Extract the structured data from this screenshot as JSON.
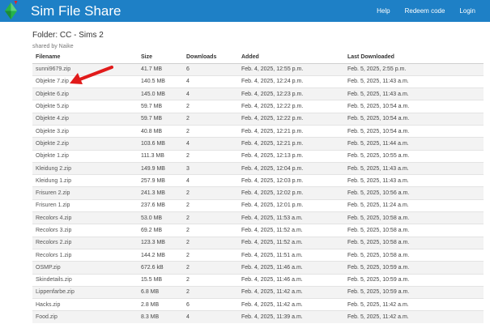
{
  "app": {
    "title": "Sim File Share"
  },
  "colors": {
    "navbar": "#1e80c6",
    "arrow": "#e11b1b",
    "row_alt": "#f3f3f3"
  },
  "nav": {
    "help": "Help",
    "redeem": "Redeem code",
    "login": "Login"
  },
  "folder": {
    "title": "Folder: CC - Sims 2",
    "shared_by": "shared by Naike"
  },
  "table": {
    "headers": {
      "filename": "Filename",
      "size": "Size",
      "downloads": "Downloads",
      "added": "Added",
      "last": "Last Downloaded"
    },
    "rows": [
      {
        "filename": "sunni9679.zip",
        "size": "41.7 MB",
        "downloads": "6",
        "added": "Feb. 4, 2025, 12:55 p.m.",
        "last": "Feb. 5, 2025, 2:55 p.m."
      },
      {
        "filename": "Objekte 7.zip",
        "size": "140.5 MB",
        "downloads": "4",
        "added": "Feb. 4, 2025, 12:24 p.m.",
        "last": "Feb. 5, 2025, 11:43 a.m."
      },
      {
        "filename": "Objekte 6.zip",
        "size": "145.0 MB",
        "downloads": "4",
        "added": "Feb. 4, 2025, 12:23 p.m.",
        "last": "Feb. 5, 2025, 11:43 a.m."
      },
      {
        "filename": "Objekte 5.zip",
        "size": "59.7 MB",
        "downloads": "2",
        "added": "Feb. 4, 2025, 12:22 p.m.",
        "last": "Feb. 5, 2025, 10:54 a.m."
      },
      {
        "filename": "Objekte 4.zip",
        "size": "59.7 MB",
        "downloads": "2",
        "added": "Feb. 4, 2025, 12:22 p.m.",
        "last": "Feb. 5, 2025, 10:54 a.m."
      },
      {
        "filename": "Objekte 3.zip",
        "size": "40.8 MB",
        "downloads": "2",
        "added": "Feb. 4, 2025, 12:21 p.m.",
        "last": "Feb. 5, 2025, 10:54 a.m."
      },
      {
        "filename": "Objekte 2.zip",
        "size": "103.6 MB",
        "downloads": "4",
        "added": "Feb. 4, 2025, 12:21 p.m.",
        "last": "Feb. 5, 2025, 11:44 a.m."
      },
      {
        "filename": "Objekte 1.zip",
        "size": "111.3 MB",
        "downloads": "2",
        "added": "Feb. 4, 2025, 12:13 p.m.",
        "last": "Feb. 5, 2025, 10:55 a.m."
      },
      {
        "filename": "Kleidung 2.zip",
        "size": "149.9 MB",
        "downloads": "3",
        "added": "Feb. 4, 2025, 12:04 p.m.",
        "last": "Feb. 5, 2025, 11:43 a.m."
      },
      {
        "filename": "Kleidung 1.zip",
        "size": "257.9 MB",
        "downloads": "4",
        "added": "Feb. 4, 2025, 12:03 p.m.",
        "last": "Feb. 5, 2025, 11:43 a.m."
      },
      {
        "filename": "Frisuren 2.zip",
        "size": "241.3 MB",
        "downloads": "2",
        "added": "Feb. 4, 2025, 12:02 p.m.",
        "last": "Feb. 5, 2025, 10:56 a.m."
      },
      {
        "filename": "Frisuren 1.zip",
        "size": "237.6 MB",
        "downloads": "2",
        "added": "Feb. 4, 2025, 12:01 p.m.",
        "last": "Feb. 5, 2025, 11:24 a.m."
      },
      {
        "filename": "Recolors 4.zip",
        "size": "53.0 MB",
        "downloads": "2",
        "added": "Feb. 4, 2025, 11:53 a.m.",
        "last": "Feb. 5, 2025, 10:58 a.m."
      },
      {
        "filename": "Recolors 3.zip",
        "size": "69.2 MB",
        "downloads": "2",
        "added": "Feb. 4, 2025, 11:52 a.m.",
        "last": "Feb. 5, 2025, 10:58 a.m."
      },
      {
        "filename": "Recolors 2.zip",
        "size": "123.3 MB",
        "downloads": "2",
        "added": "Feb. 4, 2025, 11:52 a.m.",
        "last": "Feb. 5, 2025, 10:58 a.m."
      },
      {
        "filename": "Recolors 1.zip",
        "size": "144.2 MB",
        "downloads": "2",
        "added": "Feb. 4, 2025, 11:51 a.m.",
        "last": "Feb. 5, 2025, 10:58 a.m."
      },
      {
        "filename": "OSMP.zip",
        "size": "672.6 kB",
        "downloads": "2",
        "added": "Feb. 4, 2025, 11:46 a.m.",
        "last": "Feb. 5, 2025, 10:59 a.m."
      },
      {
        "filename": "Skindetails.zip",
        "size": "15.5 MB",
        "downloads": "2",
        "added": "Feb. 4, 2025, 11:46 a.m.",
        "last": "Feb. 5, 2025, 10:59 a.m."
      },
      {
        "filename": "Lippenfarbe.zip",
        "size": "6.8 MB",
        "downloads": "2",
        "added": "Feb. 4, 2025, 11:42 a.m.",
        "last": "Feb. 5, 2025, 10:59 a.m."
      },
      {
        "filename": "Hacks.zip",
        "size": "2.8 MB",
        "downloads": "6",
        "added": "Feb. 4, 2025, 11:42 a.m.",
        "last": "Feb. 5, 2025, 11:42 a.m."
      },
      {
        "filename": "Food.zip",
        "size": "8.3 MB",
        "downloads": "4",
        "added": "Feb. 4, 2025, 11:39 a.m.",
        "last": "Feb. 5, 2025, 11:42 a.m."
      }
    ]
  }
}
